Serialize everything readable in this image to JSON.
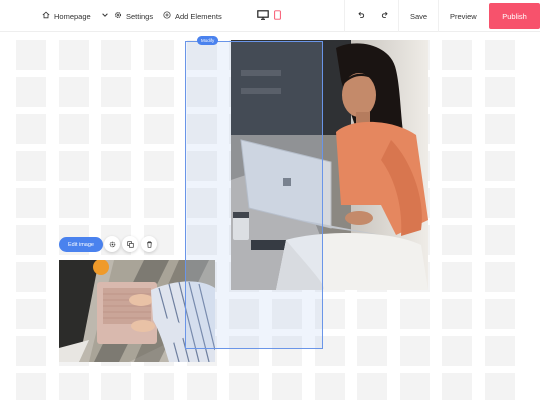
{
  "toolbar": {
    "pages_label": "Homepage",
    "settings_label": "Settings",
    "add_elements_label": "Add Elements",
    "save_label": "Save",
    "preview_label": "Preview",
    "publish_label": "Publish"
  },
  "canvas": {
    "selection_badge": "Modify",
    "edit_image_label": "Edit image"
  },
  "colors": {
    "accent": "#4a82ee",
    "publish": "#f7526c",
    "mobile_active": "#f7526c"
  },
  "icons": [
    "home-icon",
    "chevron-down-icon",
    "gear-icon",
    "plus-circle-icon",
    "desktop-icon",
    "mobile-icon",
    "undo-icon",
    "redo-icon",
    "settings-icon",
    "duplicate-icon",
    "trash-icon"
  ]
}
